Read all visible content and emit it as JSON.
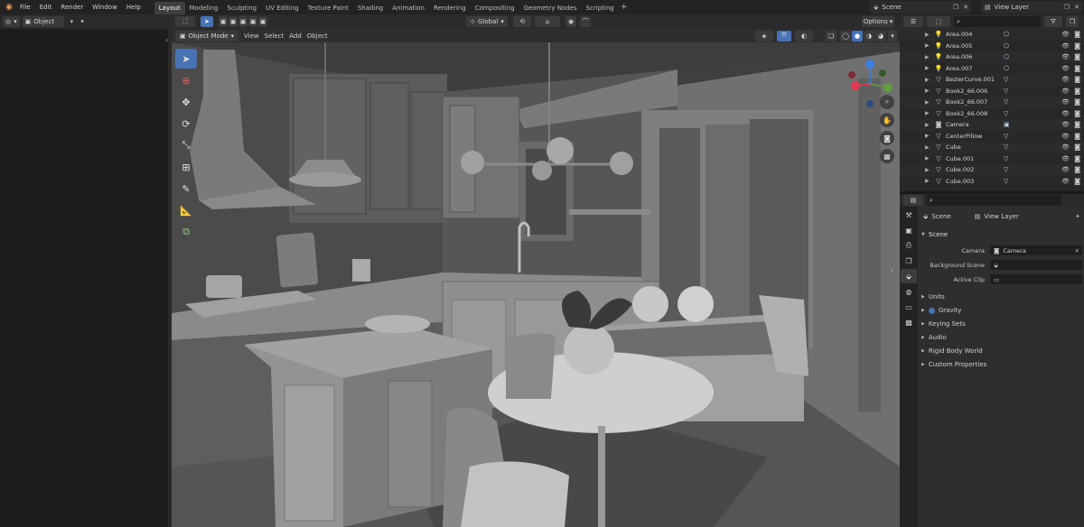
{
  "menubar": {
    "items": [
      "File",
      "Edit",
      "Render",
      "Window",
      "Help"
    ],
    "workspaces": [
      "Layout",
      "Modeling",
      "Sculpting",
      "UV Editing",
      "Texture Paint",
      "Shading",
      "Animation",
      "Rendering",
      "Compositing",
      "Geometry Nodes",
      "Scripting"
    ],
    "active_workspace": "Layout",
    "scene": "Scene",
    "view_layer": "View Layer"
  },
  "left_editor": {
    "mode": "Object"
  },
  "viewport": {
    "mode": "Object Mode",
    "menus": [
      "View",
      "Select",
      "Add",
      "Object"
    ],
    "transform_orientation": "Global",
    "options_label": "Options"
  },
  "outliner": {
    "rows": [
      {
        "name": "Area.004",
        "icon": "light-icon",
        "data": "area-data-icon"
      },
      {
        "name": "Area.005",
        "icon": "light-icon",
        "data": "area-data-icon"
      },
      {
        "name": "Area.006",
        "icon": "light-icon",
        "data": "area-data-icon"
      },
      {
        "name": "Area.007",
        "icon": "light-icon",
        "data": "area-data-icon"
      },
      {
        "name": "BezierCurve.001",
        "icon": "object-icon",
        "data": "mesh-data-icon"
      },
      {
        "name": "Book2_66.006",
        "icon": "object-icon",
        "data": "mesh-data-icon"
      },
      {
        "name": "Book2_66.007",
        "icon": "object-icon",
        "data": "mesh-data-icon"
      },
      {
        "name": "Book2_66.008",
        "icon": "object-icon",
        "data": "mesh-data-icon"
      },
      {
        "name": "Camera",
        "icon": "camera-icon",
        "data": "camera-data-icon"
      },
      {
        "name": "CenterPillow",
        "icon": "object-icon",
        "data": "mesh-data-icon"
      },
      {
        "name": "Cube",
        "icon": "object-icon",
        "data": "mesh-data-icon"
      },
      {
        "name": "Cube.001",
        "icon": "object-icon",
        "data": "mesh-data-icon"
      },
      {
        "name": "Cube.002",
        "icon": "object-icon",
        "data": "mesh-data-icon"
      },
      {
        "name": "Cube.003",
        "icon": "object-icon",
        "data": "mesh-data-icon"
      }
    ]
  },
  "properties": {
    "breadcrumb": {
      "scene": "Scene",
      "view_layer": "View Layer"
    },
    "scene_panel": {
      "title": "Scene",
      "camera_label": "Camera",
      "camera_value": "Camera",
      "background_label": "Background Scene",
      "clip_label": "Active Clip"
    },
    "collapsed_panels": [
      "Units",
      "Gravity",
      "Keying Sets",
      "Audio",
      "Rigid Body World",
      "Custom Properties"
    ]
  },
  "colors": {
    "accent": "#4772b3",
    "gizmo_x": "#e33a4f",
    "gizmo_y": "#62a03b",
    "gizmo_z": "#3e7ee0"
  }
}
